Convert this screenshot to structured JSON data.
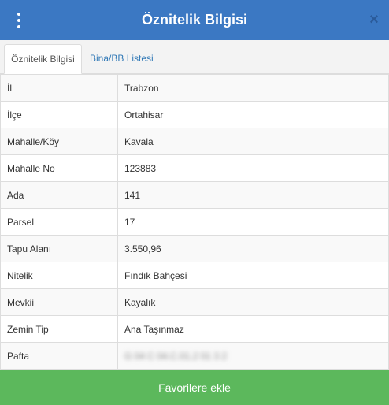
{
  "header": {
    "title": "Öznitelik Bilgisi",
    "close_icon": "×"
  },
  "tabs": [
    {
      "label": "Öznitelik Bilgisi",
      "active": true
    },
    {
      "label": "Bina/BB Listesi",
      "active": false
    }
  ],
  "attributes": [
    {
      "key": "İl",
      "value": "Trabzon"
    },
    {
      "key": "İlçe",
      "value": "Ortahisar"
    },
    {
      "key": "Mahalle/Köy",
      "value": "Kavala"
    },
    {
      "key": "Mahalle No",
      "value": "123883"
    },
    {
      "key": "Ada",
      "value": "141"
    },
    {
      "key": "Parsel",
      "value": "17"
    },
    {
      "key": "Tapu Alanı",
      "value": "3.550,96"
    },
    {
      "key": "Nitelik",
      "value": "Fındık Bahçesi"
    },
    {
      "key": "Mevkii",
      "value": "Kayalık"
    },
    {
      "key": "Zemin Tip",
      "value": "Ana Taşınmaz"
    },
    {
      "key": "Pafta",
      "value": "G 04 C 04.C.01.2 01 3 2"
    }
  ],
  "footer": {
    "favorite_label": "Favorilere ekle"
  },
  "colors": {
    "header": "#3b78c3",
    "footer": "#5cb85c",
    "tab_link": "#337ab7"
  }
}
